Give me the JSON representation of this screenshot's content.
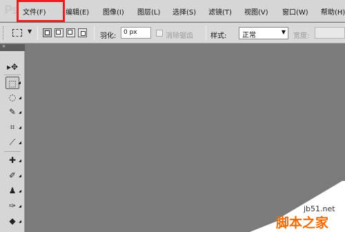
{
  "app": {
    "logo": "Ps"
  },
  "menubar": {
    "items": [
      {
        "id": "file",
        "label": "文件(F)"
      },
      {
        "id": "edit",
        "label": "编辑(E)"
      },
      {
        "id": "image",
        "label": "图像(I)"
      },
      {
        "id": "layer",
        "label": "图层(L)"
      },
      {
        "id": "select",
        "label": "选择(S)"
      },
      {
        "id": "filter",
        "label": "滤镜(T)"
      },
      {
        "id": "view",
        "label": "视图(V)"
      },
      {
        "id": "window",
        "label": "窗口(W)"
      },
      {
        "id": "help",
        "label": "帮助(H)"
      }
    ],
    "highlight_color": "#ef1c1c"
  },
  "options": {
    "feather_label": "羽化:",
    "feather_value": "0 px",
    "antialias_label": "消除锯齿",
    "style_label": "样式:",
    "style_value": "正常",
    "width_label": "宽度:"
  },
  "toolbox": {
    "collapse_glyph": "»",
    "tools": [
      {
        "id": "move",
        "icon": "move-icon",
        "glyph": "▸✥"
      },
      {
        "id": "marquee",
        "icon": "rect-marquee-icon",
        "glyph": "⬚",
        "selected": true
      },
      {
        "id": "lasso",
        "icon": "lasso-icon",
        "glyph": "◌"
      },
      {
        "id": "quick-select",
        "icon": "quick-select-icon",
        "glyph": "✎"
      },
      {
        "id": "crop",
        "icon": "crop-icon",
        "glyph": "⌗"
      },
      {
        "id": "eyedropper",
        "icon": "eyedropper-icon",
        "glyph": "⟋"
      },
      {
        "id": "healing",
        "icon": "healing-brush-icon",
        "glyph": "✚"
      },
      {
        "id": "brush",
        "icon": "brush-icon",
        "glyph": "✐"
      },
      {
        "id": "stamp",
        "icon": "clone-stamp-icon",
        "glyph": "♟"
      },
      {
        "id": "history-brush",
        "icon": "history-brush-icon",
        "glyph": "✑"
      },
      {
        "id": "eraser",
        "icon": "eraser-icon",
        "glyph": "◆"
      }
    ]
  },
  "colors": {
    "canvas": "#7b7b7b",
    "chrome": "#d6d6d6",
    "accent": "#f06a00"
  },
  "watermark": {
    "url": "jb51.net",
    "text": "脚本之家"
  }
}
